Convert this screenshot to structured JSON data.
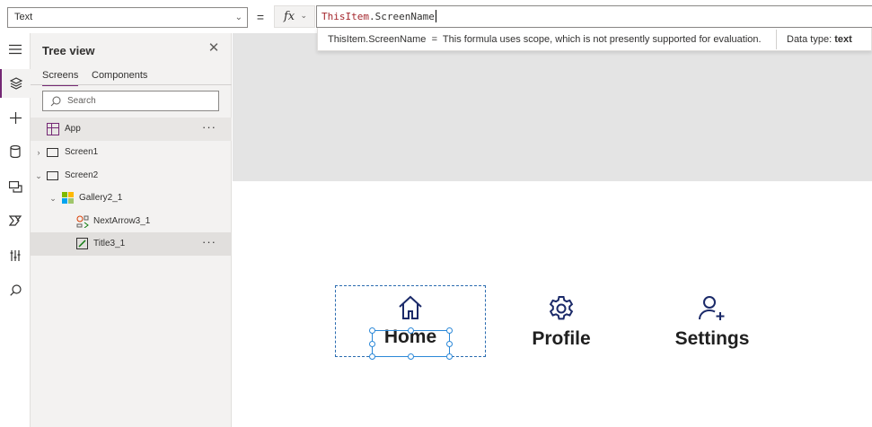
{
  "formula_bar": {
    "property": "Text",
    "equals": "=",
    "fx": "fx",
    "formula_object": "ThisItem",
    "formula_rest": ".ScreenName"
  },
  "eval_tooltip": {
    "expression": "ThisItem.ScreenName",
    "equals": "=",
    "message": "This formula uses scope, which is not presently supported for evaluation.",
    "data_type_label": "Data type:",
    "data_type_value": "text"
  },
  "tree_view": {
    "title": "Tree view",
    "tabs": [
      {
        "label": "Screens",
        "active": true
      },
      {
        "label": "Components",
        "active": false
      }
    ],
    "search_placeholder": "Search",
    "nodes": [
      {
        "label": "App",
        "more": "···"
      },
      {
        "label": "Screen1"
      },
      {
        "label": "Screen2"
      },
      {
        "label": "Gallery2_1"
      },
      {
        "label": "NextArrow3_1"
      },
      {
        "label": "Title3_1",
        "more": "···"
      }
    ]
  },
  "canvas": {
    "items": [
      {
        "label": "Home",
        "icon": "home-icon"
      },
      {
        "label": "Profile",
        "icon": "gear-icon"
      },
      {
        "label": "Settings",
        "icon": "add-user-icon"
      }
    ]
  },
  "colors": {
    "accent": "#742774",
    "selection": "#2b88d8",
    "icon_navy": "#1b2a69"
  }
}
